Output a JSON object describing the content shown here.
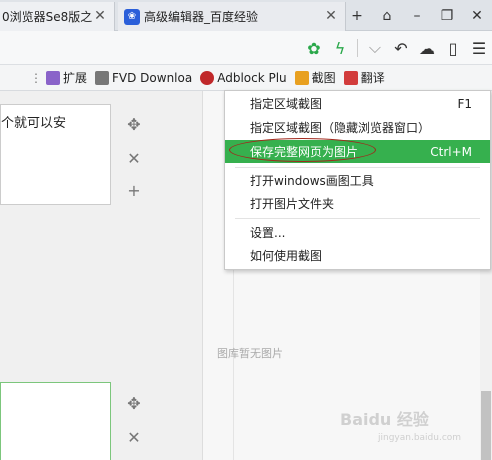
{
  "tabs": [
    {
      "title": "0浏览器Se8版之"
    },
    {
      "title": "高级编辑器_百度经验"
    }
  ],
  "window_buttons": [
    "+",
    "⌂",
    "–",
    "❐",
    "✕"
  ],
  "toolbar_icons": [
    "gear-icon",
    "bolt-icon",
    "chevron-down-icon",
    "undo-icon",
    "cloud-icon",
    "phone-icon",
    "menu-icon"
  ],
  "bookmarks": [
    {
      "label": "扩展",
      "color": "#8a63c9"
    },
    {
      "label": "FVD Downloa",
      "color": "#777777"
    },
    {
      "label": "Adblock Plu",
      "color": "#c0282a"
    },
    {
      "label": "截图",
      "color": "#e8a020"
    },
    {
      "label": "翻译",
      "color": "#d23c3c"
    }
  ],
  "editor": {
    "text1": "个就可以安",
    "no_image": "图库暂无图片"
  },
  "watermark": {
    "text": "Baidu 经验",
    "sub": "jingyan.baidu.com"
  },
  "menu": {
    "items": [
      {
        "label": "指定区域截图",
        "shortcut": "F1"
      },
      {
        "label": "指定区域截图（隐藏浏览器窗口）",
        "shortcut": ""
      },
      {
        "label": "保存完整网页为图片",
        "shortcut": "Ctrl+M"
      },
      {
        "label": "打开windows画图工具",
        "shortcut": ""
      },
      {
        "label": "打开图片文件夹",
        "shortcut": ""
      },
      {
        "label": "设置...",
        "shortcut": ""
      },
      {
        "label": "如何使用截图",
        "shortcut": ""
      }
    ]
  },
  "colors": {
    "accent": "#36b04e",
    "annotation": "#a0281c"
  }
}
